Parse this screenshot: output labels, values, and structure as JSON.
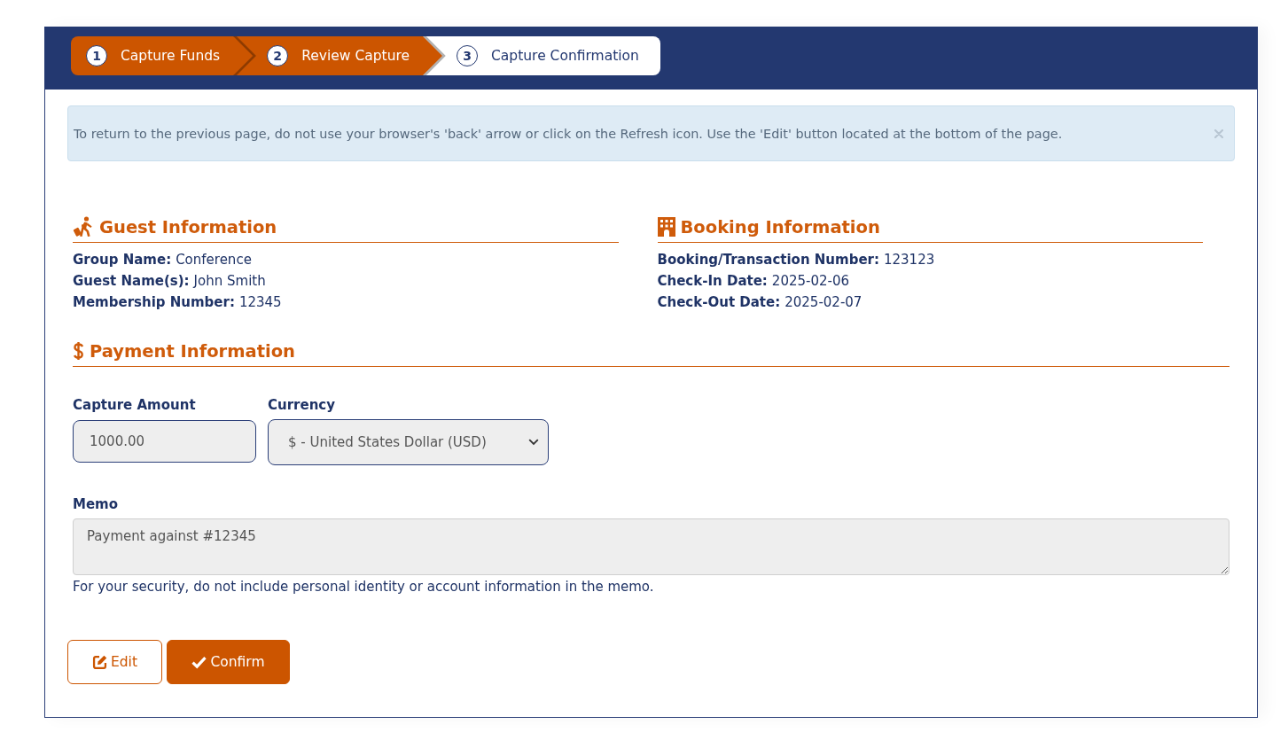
{
  "steps": [
    {
      "number": "1",
      "label": "Capture Funds",
      "selected": false
    },
    {
      "number": "2",
      "label": "Review Capture",
      "selected": false
    },
    {
      "number": "3",
      "label": "Capture Confirmation",
      "selected": true
    }
  ],
  "alert": {
    "text": "To return to the previous page, do not use your browser's 'back' arrow or click on the Refresh icon. Use the 'Edit' button located at the bottom of the page.",
    "dismissible": true
  },
  "guest_information": {
    "title": "Guest Information",
    "fields": [
      {
        "label": "Group Name:",
        "value": "Conference"
      },
      {
        "label": "Guest Name(s):",
        "value": "John Smith"
      },
      {
        "label": "Membership Number:",
        "value": "12345"
      }
    ]
  },
  "booking_information": {
    "title": "Booking Information",
    "fields": [
      {
        "label": "Booking/Transaction Number:",
        "value": "123123"
      },
      {
        "label": "Check-In Date:",
        "value": "2025-02-06"
      },
      {
        "label": "Check-Out Date:",
        "value": "2025-02-07"
      }
    ]
  },
  "payment_information": {
    "title": "Payment Information",
    "capture_amount": {
      "label": "Capture Amount",
      "value": "1000.00",
      "readonly": true
    },
    "currency": {
      "label": "Currency",
      "value": "$ - United States Dollar (USD)",
      "readonly": true
    },
    "memo": {
      "label": "Memo",
      "value": "Payment against #12345",
      "readonly": true,
      "help": "For your security, do not include personal identity or account information in the memo."
    }
  },
  "buttons": [
    {
      "label": "Edit",
      "kind": "secondary"
    },
    {
      "label": "Confirm",
      "kind": "primary"
    }
  ]
}
